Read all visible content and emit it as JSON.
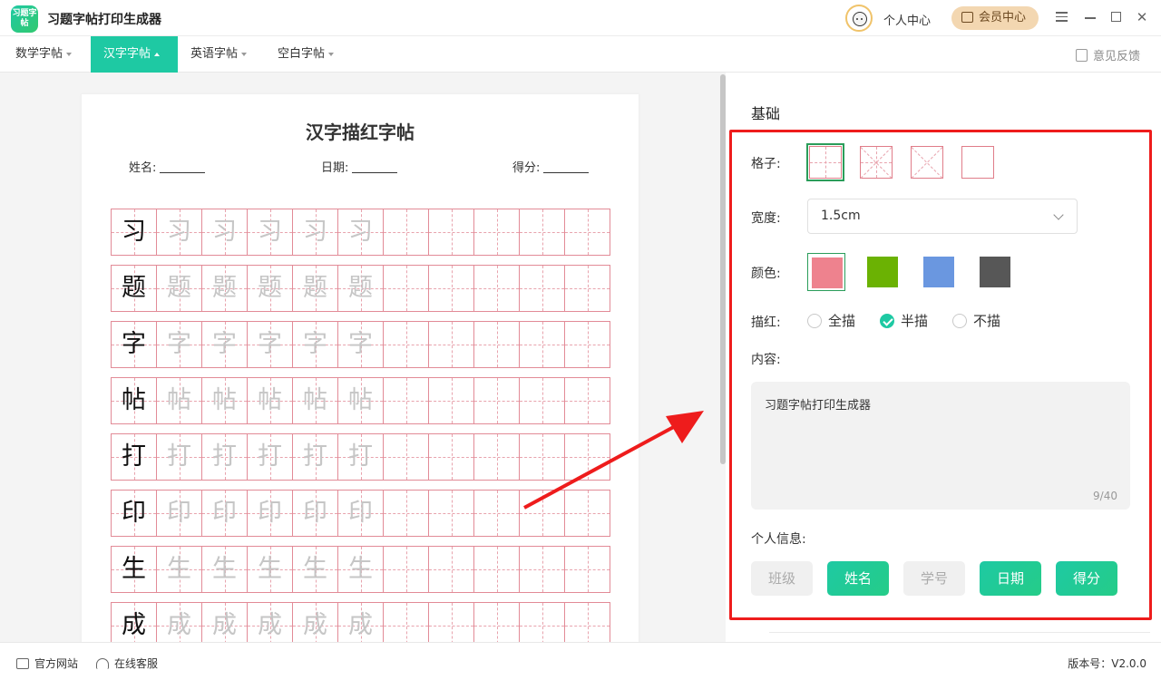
{
  "app": {
    "logo_text": "习题字帖",
    "title": "习题字帖打印生成器"
  },
  "header": {
    "personal_center": "个人中心",
    "vip_center": "会员中心"
  },
  "tabs": [
    {
      "label": "数学字帖",
      "active": false
    },
    {
      "label": "汉字字帖",
      "active": true
    },
    {
      "label": "英语字帖",
      "active": false
    },
    {
      "label": "空白字帖",
      "active": false
    }
  ],
  "feedback": "意见反馈",
  "paper": {
    "title": "汉字描红字帖",
    "name_label": "姓名:",
    "date_label": "日期:",
    "score_label": "得分:",
    "rows": [
      "习",
      "题",
      "字",
      "帖",
      "打",
      "印",
      "生",
      "成"
    ],
    "trace_count": 5,
    "cells_per_row": 11
  },
  "settings": {
    "section_title": "基础",
    "grid_label": "格子:",
    "grid_options": [
      "tian-grid",
      "mi-grid",
      "x-grid",
      "blank-grid"
    ],
    "grid_selected": 0,
    "width_label": "宽度:",
    "width_value": "1.5cm",
    "color_label": "颜色:",
    "colors": [
      "#ee828e",
      "#6bb203",
      "#6a97e0",
      "#575757"
    ],
    "color_selected": 0,
    "trace_label": "描红:",
    "trace_options": [
      {
        "label": "全描",
        "checked": false
      },
      {
        "label": "半描",
        "checked": true
      },
      {
        "label": "不描",
        "checked": false
      }
    ],
    "content_label": "内容:",
    "content_value": "习题字帖打印生成器",
    "content_counter": "9/40",
    "info_label": "个人信息:",
    "info_tags": [
      {
        "label": "班级",
        "on": false
      },
      {
        "label": "姓名",
        "on": true
      },
      {
        "label": "学号",
        "on": false
      },
      {
        "label": "日期",
        "on": true
      },
      {
        "label": "得分",
        "on": true
      }
    ]
  },
  "footer": {
    "website": "官方网站",
    "support": "在线客服",
    "version": "版本号：V2.0.0"
  },
  "accent_color": "#1ec9a3",
  "highlight_color": "#ee1c1c"
}
